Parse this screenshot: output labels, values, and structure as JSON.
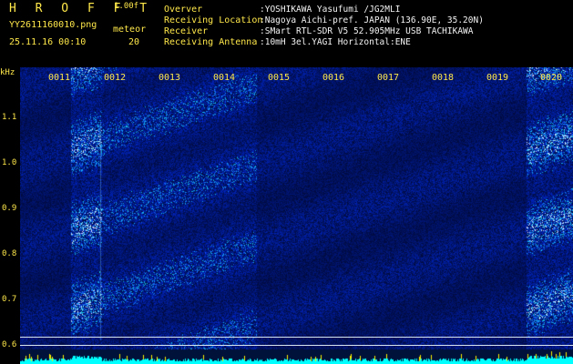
{
  "header": {
    "app_title": "H R O F F T",
    "version": "1.00f",
    "filename": "YY2611160010.png",
    "timestamp": "25.11.16 00:10",
    "type_label": "meteor",
    "type_count": "20",
    "info": [
      {
        "label": "Overver",
        "value": ":YOSHIKAWA Yasufumi /JG2MLI"
      },
      {
        "label": "Receiving Location",
        "value": ":Nagoya Aichi-pref. JAPAN (136.90E, 35.20N)"
      },
      {
        "label": "Receiver",
        "value": ":SMart RTL-SDR V5 52.905MHz USB TACHIKAWA"
      },
      {
        "label": "Receiving Antenna",
        "value": ":10mH 3el.YAGI Horizontal:ENE"
      }
    ]
  },
  "axis": {
    "unit": "kHz",
    "freq_ticks": [
      "1.1",
      "1.0",
      "0.9",
      "0.8",
      "0.7",
      "0.6"
    ],
    "time_labels": [
      "0011",
      "0012",
      "0013",
      "0014",
      "0015",
      "0016",
      "0017",
      "0018",
      "0019",
      "0020"
    ]
  },
  "colors": {
    "label": "#ffe84a",
    "value": "#f4f4f4",
    "background": "#000000",
    "noise_floor": "#00ffff"
  },
  "chart_data": {
    "type": "heatmap",
    "x_unit": "minutes (HHMM)",
    "x_range": [
      "0010",
      "0020"
    ],
    "y_unit": "kHz",
    "y_range": [
      0.58,
      1.16
    ],
    "bright_bands": [
      "0011",
      "0012",
      "0020"
    ]
  }
}
